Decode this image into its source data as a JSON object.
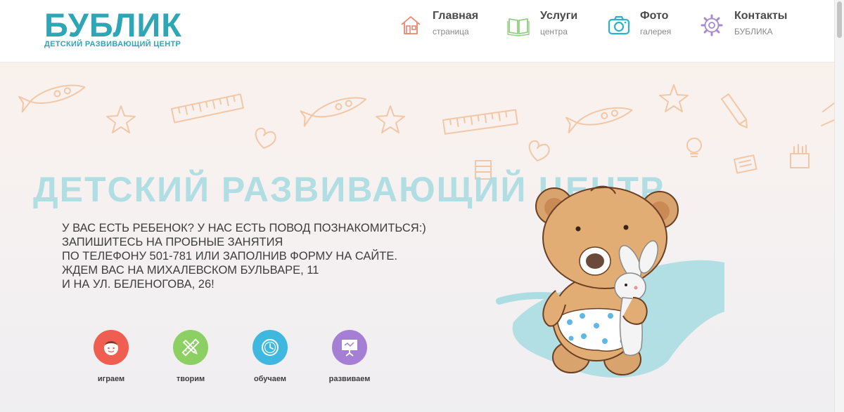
{
  "logo": {
    "title": "БУБЛИК",
    "subtitle": "ДЕТСКИЙ РАЗВИВАЮЩИЙ ЦЕНТР",
    "color": "#2fa6b5"
  },
  "nav": [
    {
      "title": "Главная",
      "subtitle": "страница",
      "icon": "home-icon",
      "color": "#e9866d"
    },
    {
      "title": "Услуги",
      "subtitle": "центра",
      "icon": "book-icon",
      "color": "#8fcf7f"
    },
    {
      "title": "Фото",
      "subtitle": "галерея",
      "icon": "camera-icon",
      "color": "#2bb2c9"
    },
    {
      "title": "Контакты",
      "subtitle": "БУБЛИКА",
      "icon": "gear-icon",
      "color": "#a68ad0"
    }
  ],
  "hero": {
    "headline": "ДЕТСКИЙ РАЗВИВАЮЩИЙ ЦЕНТР",
    "lines": [
      "У ВАС ЕСТЬ РЕБЕНОК? У НАС ЕСТЬ ПОВОД ПОЗНАКОМИТЬСЯ:)",
      "ЗАПИШИТЕСЬ НА ПРОБНЫЕ ЗАНЯТИЯ",
      "ПО ТЕЛЕФОНУ 501-781 ИЛИ ЗАПОЛНИВ ФОРМУ НА САЙТЕ.",
      "ЖДЕМ ВАС НА МИХАЛЕВСКОМ БУЛЬВАРЕ, 11",
      "И НА УЛ. БЕЛЕНОГОВА, 26!"
    ]
  },
  "features": [
    {
      "label": "играем",
      "icon": "child-face-icon",
      "color": "#ef5e50"
    },
    {
      "label": "творим",
      "icon": "ruler-pencil-icon",
      "color": "#8ccf62"
    },
    {
      "label": "обучаем",
      "icon": "clock-icon",
      "color": "#3fb8e0"
    },
    {
      "label": "развиваем",
      "icon": "presentation-board-icon",
      "color": "#a57fd6"
    }
  ]
}
